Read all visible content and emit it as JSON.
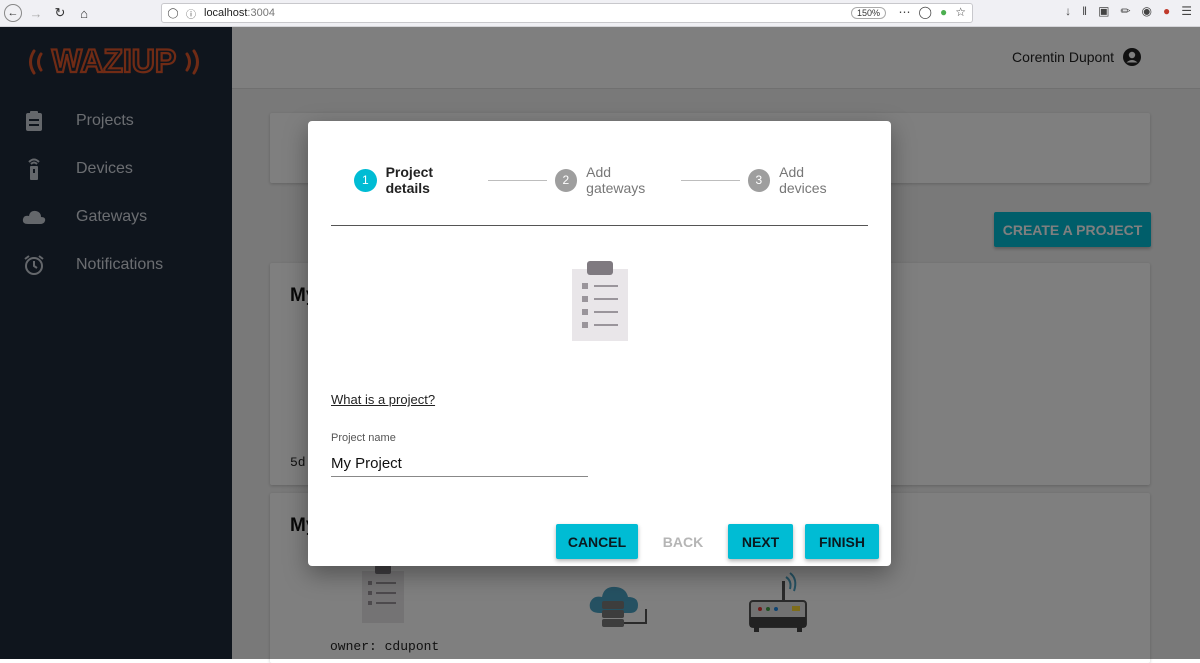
{
  "browser": {
    "url_host": "localhost",
    "url_port": ":3004",
    "zoom": "150%"
  },
  "app": {
    "logo": "wazIup",
    "nav": [
      {
        "label": "Projects",
        "icon": "clipboard-icon"
      },
      {
        "label": "Devices",
        "icon": "device-icon"
      },
      {
        "label": "Gateways",
        "icon": "cloud-icon"
      },
      {
        "label": "Notifications",
        "icon": "alarm-clock-icon"
      }
    ],
    "user_name": "Corentin Dupont",
    "create_button": "CREATE A PROJECT",
    "card1_title": "My",
    "card1_code": "5d",
    "card2_title": "My",
    "card2_owner": "owner: cdupont"
  },
  "dialog": {
    "steps": [
      {
        "number": "1",
        "label": "Project details",
        "state": "active"
      },
      {
        "number": "2",
        "label": "Add gateways",
        "state": "inactive"
      },
      {
        "number": "3",
        "label": "Add devices",
        "state": "inactive"
      }
    ],
    "help_link": "What is a project?",
    "field_label": "Project name",
    "field_value": "My Project",
    "buttons": {
      "cancel": "CANCEL",
      "back": "BACK",
      "next": "NEXT",
      "finish": "FINISH"
    }
  },
  "colors": {
    "accent": "#00bcd4",
    "sidebar": "#1e2a3b",
    "logo_orange": "#e0572a"
  }
}
